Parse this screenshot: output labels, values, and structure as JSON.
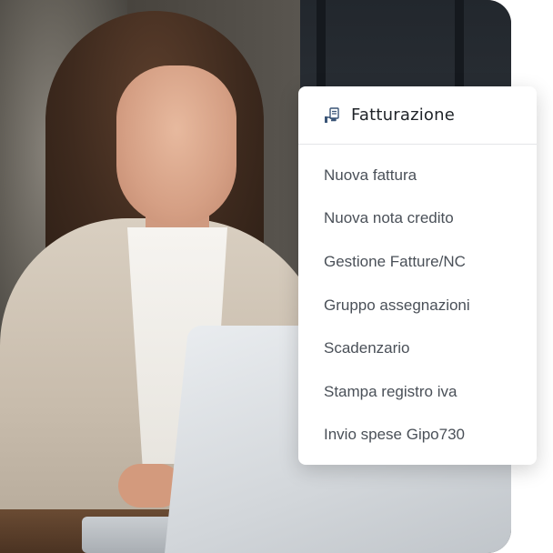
{
  "menu": {
    "title": "Fatturazione",
    "header_icon": "invoice-hand-icon",
    "items": [
      {
        "label": "Nuova fattura"
      },
      {
        "label": "Nuova nota credito"
      },
      {
        "label": "Gestione Fatture/NC"
      },
      {
        "label": "Gruppo assegnazioni"
      },
      {
        "label": "Scadenzario"
      },
      {
        "label": "Stampa registro iva"
      },
      {
        "label": "Invio spese Gipo730"
      }
    ]
  },
  "colors": {
    "menu_bg": "#ffffff",
    "title_text": "#1f2328",
    "item_text": "#4a5058",
    "divider": "#e4e6e8",
    "icon_accent": "#3a5577"
  }
}
